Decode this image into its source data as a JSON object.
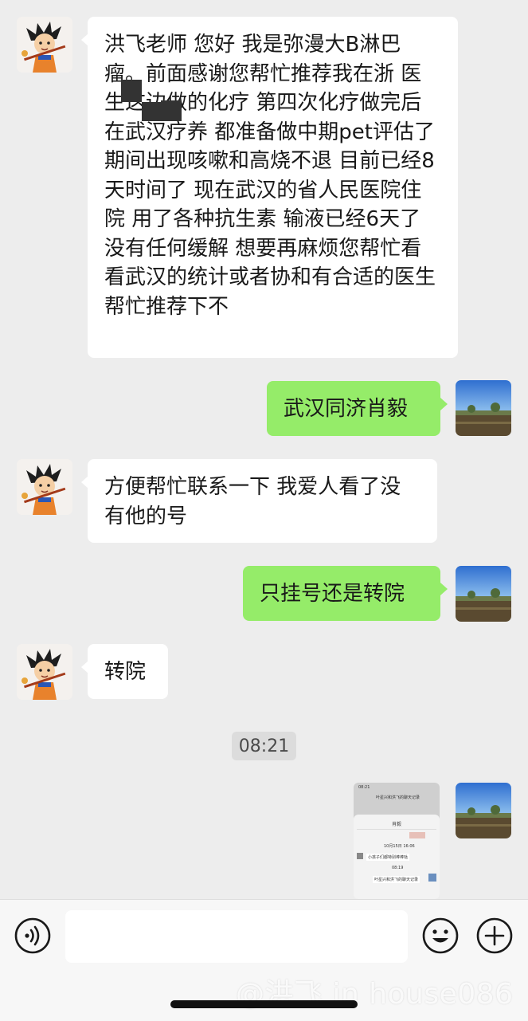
{
  "chat": {
    "messages": [
      {
        "sender": "contact",
        "text": "洪飞老师 您好 我是弥漫大B淋巴瘤。前面感谢您帮忙推荐我在浙 医生这边做的化疗 第四次化疗做完后在武汉疗养 都准备做中期pet评估了 期间出现咳嗽和高烧不退 目前已经8天时间了 现在武汉的省人民医院住院 用了各种抗生素 输液已经6天了 没有任何缓解 想要再麻烦您帮忙看看武汉的统计或者协和有合适的医生帮忙推荐下不"
      },
      {
        "sender": "me",
        "text": "武汉同济肖毅"
      },
      {
        "sender": "contact",
        "text": "方便帮忙联系一下 我爱人看了没有他的号"
      },
      {
        "sender": "me",
        "text": "只挂号还是转院"
      },
      {
        "sender": "contact",
        "text": "转院"
      }
    ],
    "timestamp": "08:21",
    "screenshot_thumb": {
      "time": "08:21",
      "title": "叶星兴和洪飞的聊天记录",
      "panel_title": "肖毅",
      "date": "10月15日 16:06",
      "bubble": "小孩子们都特别棒棒哒",
      "time2": "08:19",
      "bottom": "叶星兴和洪飞的聊天记录"
    }
  },
  "input_bar": {
    "voice_icon": "voice-icon",
    "emoji_icon": "emoji-icon",
    "plus_icon": "plus-icon"
  },
  "watermark": "@洪飞 in house086",
  "colors": {
    "background": "#ededed",
    "incoming_bubble": "#ffffff",
    "outgoing_bubble": "#95ec69"
  }
}
